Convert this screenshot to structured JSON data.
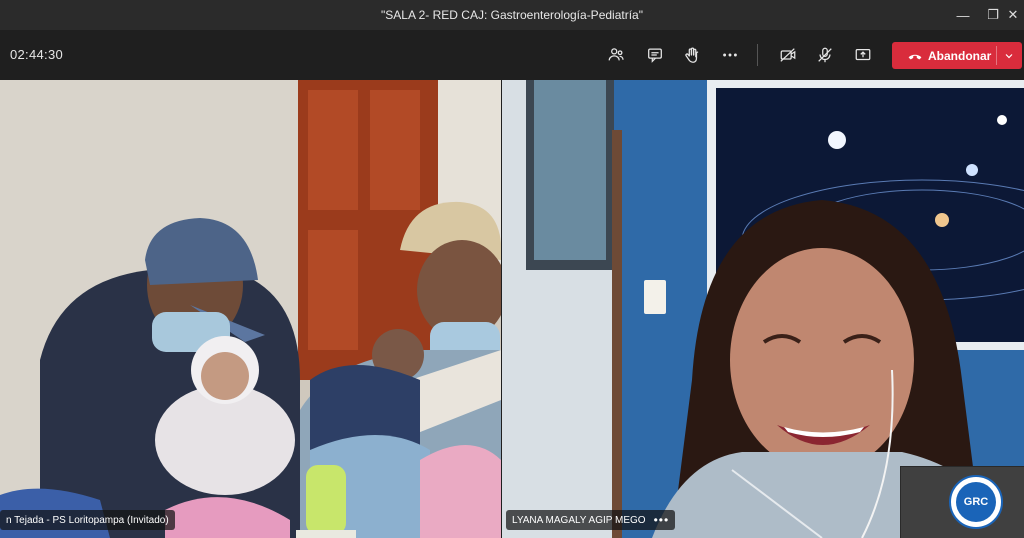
{
  "window": {
    "title": "\"SALA 2- RED CAJ: Gastroenterología-Pediatría\"",
    "minimize_glyph": "—",
    "restore_glyph": "❐",
    "close_glyph": "✕"
  },
  "toolbar": {
    "timer": "02:44:30",
    "leave_label": "Abandonar",
    "icons": [
      "participants-icon",
      "chat-icon",
      "raise-hand-icon",
      "more-actions-icon",
      "camera-off-icon",
      "mic-off-icon",
      "share-screen-icon"
    ]
  },
  "participants": [
    {
      "name": "n Tejada - PS Loritopampa (Invitado)"
    },
    {
      "name": "LYANA MAGALY AGIP MEGO",
      "more": "•••"
    }
  ],
  "selfview": {
    "logo_text": "GRC"
  },
  "colors": {
    "accent_red": "#d92c3c",
    "toolbar_bg": "#1f1f1f",
    "titlebar_bg": "#2b2b2b"
  }
}
